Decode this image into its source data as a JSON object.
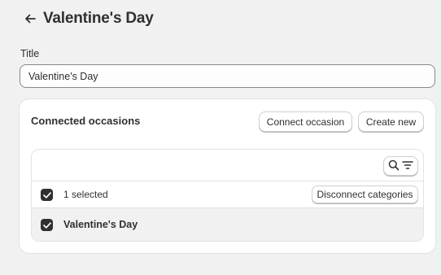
{
  "header": {
    "title": "Valentine's Day",
    "back_icon": "arrow-left-icon"
  },
  "form": {
    "title_label": "Title",
    "title_value": "Valentine's Day"
  },
  "card": {
    "title": "Connected occasions",
    "connect_button": "Connect occasion",
    "create_button": "Create new",
    "table": {
      "filter_icons": [
        "search-icon",
        "filter-icon"
      ],
      "selection": {
        "text": "1 selected",
        "action": "Disconnect categories",
        "checked": true
      },
      "rows": [
        {
          "name": "Valentine's Day",
          "checked": true
        }
      ]
    }
  }
}
